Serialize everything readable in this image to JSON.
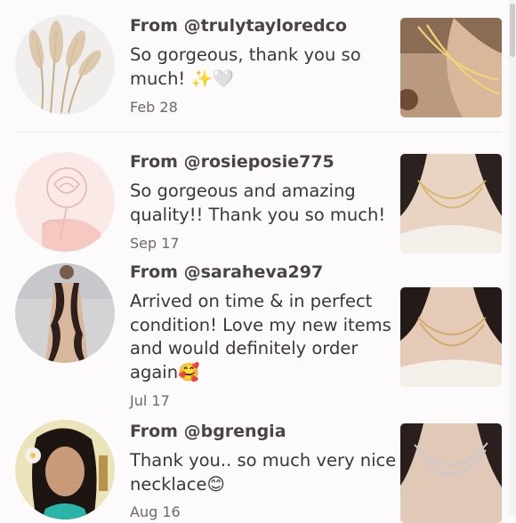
{
  "reviews": [
    {
      "author": "From @trulytayloredco",
      "comment": "So gorgeous, thank you so much! ✨🤍",
      "date": "Feb 28",
      "avatar_icon": "pampas-grass-avatar",
      "thumb_icon": "gold-necklace-photo"
    },
    {
      "author": "From @rosieposie775",
      "comment": "So gorgeous and amazing quality!! Thank you so much!",
      "date": "Sep 17",
      "avatar_icon": "rose-sketch-avatar",
      "thumb_icon": "layered-necklace-photo"
    },
    {
      "author": "From @saraheva297",
      "comment": "Arrived on time & in perfect condition! Love my new items and would definitely order again🥰",
      "date": "Jul 17",
      "avatar_icon": "lace-dress-avatar",
      "thumb_icon": "layered-necklace-photo"
    },
    {
      "author": "From @bgrengia",
      "comment": "Thank you.. so much very nice necklace😊",
      "date": "Aug 16",
      "avatar_icon": "woman-portrait-avatar",
      "thumb_icon": "silver-necklace-photo"
    }
  ],
  "colors": {
    "background": "#fcfafb",
    "author_text": "#4a4448",
    "body_text": "#3c3739",
    "date_text": "#6e676b"
  }
}
